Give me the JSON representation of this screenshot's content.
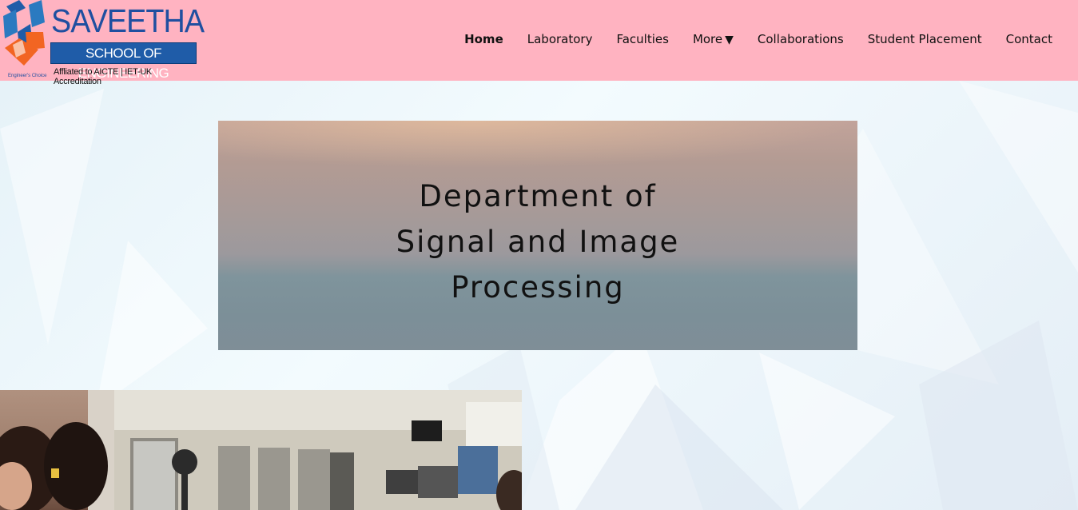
{
  "header": {
    "logo": {
      "title": "SAVEETHA",
      "subtitle": "SCHOOL OF ENGINEERING",
      "accreditation": "Affliated to AICTE | IET-UK Accreditation",
      "tagline": "Engineer's Choice"
    },
    "nav": [
      {
        "label": "Home",
        "active": true
      },
      {
        "label": "Laboratory"
      },
      {
        "label": "Faculties"
      },
      {
        "label": "More",
        "dropdown": true,
        "caret": "▼"
      },
      {
        "label": "Collaborations"
      },
      {
        "label": "Student Placement"
      },
      {
        "label": "Contact"
      }
    ],
    "background_color": "#ffb3c1"
  },
  "banner": {
    "lines": [
      "Department of",
      "Signal and Image",
      "Processing"
    ]
  },
  "photos": [
    {
      "name": "students-photo"
    },
    {
      "name": "laboratory-photo"
    }
  ],
  "colors": {
    "brand_blue": "#1f4fa0",
    "logo_orange": "#f26522"
  }
}
